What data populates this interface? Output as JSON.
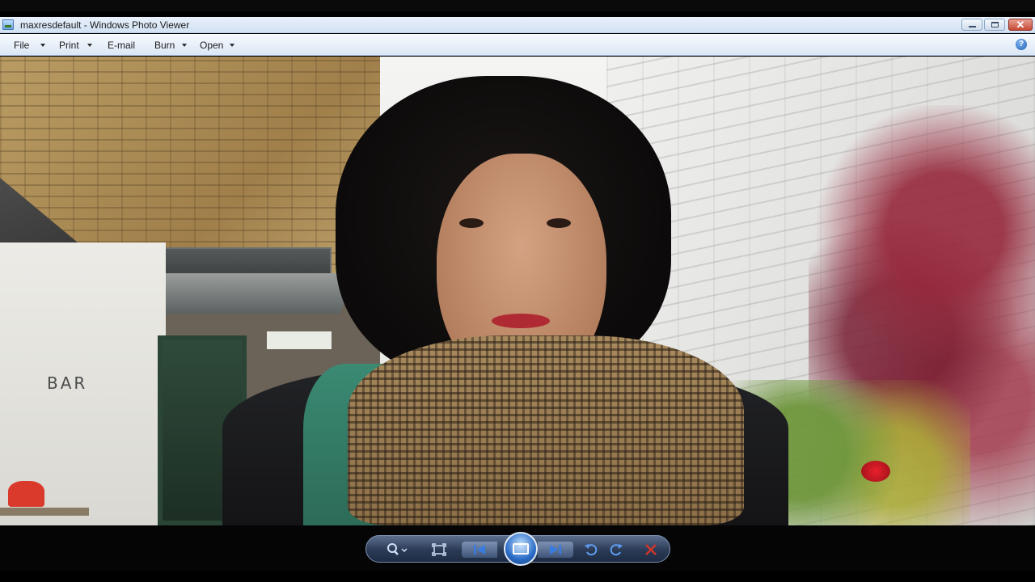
{
  "window": {
    "title": "maxresdefault - Windows Photo Viewer"
  },
  "menu": {
    "items": [
      {
        "label": "File",
        "has_dropdown": true
      },
      {
        "label": "Print",
        "has_dropdown": true
      },
      {
        "label": "E-mail",
        "has_dropdown": false
      },
      {
        "label": "Burn",
        "has_dropdown": true
      },
      {
        "label": "Open",
        "has_dropdown": true
      }
    ],
    "help_icon": "help-icon",
    "help_glyph": "?"
  },
  "photo": {
    "sign_text": "BAR"
  },
  "controls": {
    "zoom_icon": "zoom-icon",
    "fit_icon": "actual-size-icon",
    "prev_icon": "previous-icon",
    "slideshow_icon": "slideshow-icon",
    "next_icon": "next-icon",
    "rotate_ccw_icon": "rotate-counterclockwise-icon",
    "rotate_cw_icon": "rotate-clockwise-icon",
    "delete_icon": "delete-icon"
  },
  "colors": {
    "accent": "#2a6cc6",
    "delete": "#d0352a",
    "titlebar": "#d2e2f4"
  }
}
